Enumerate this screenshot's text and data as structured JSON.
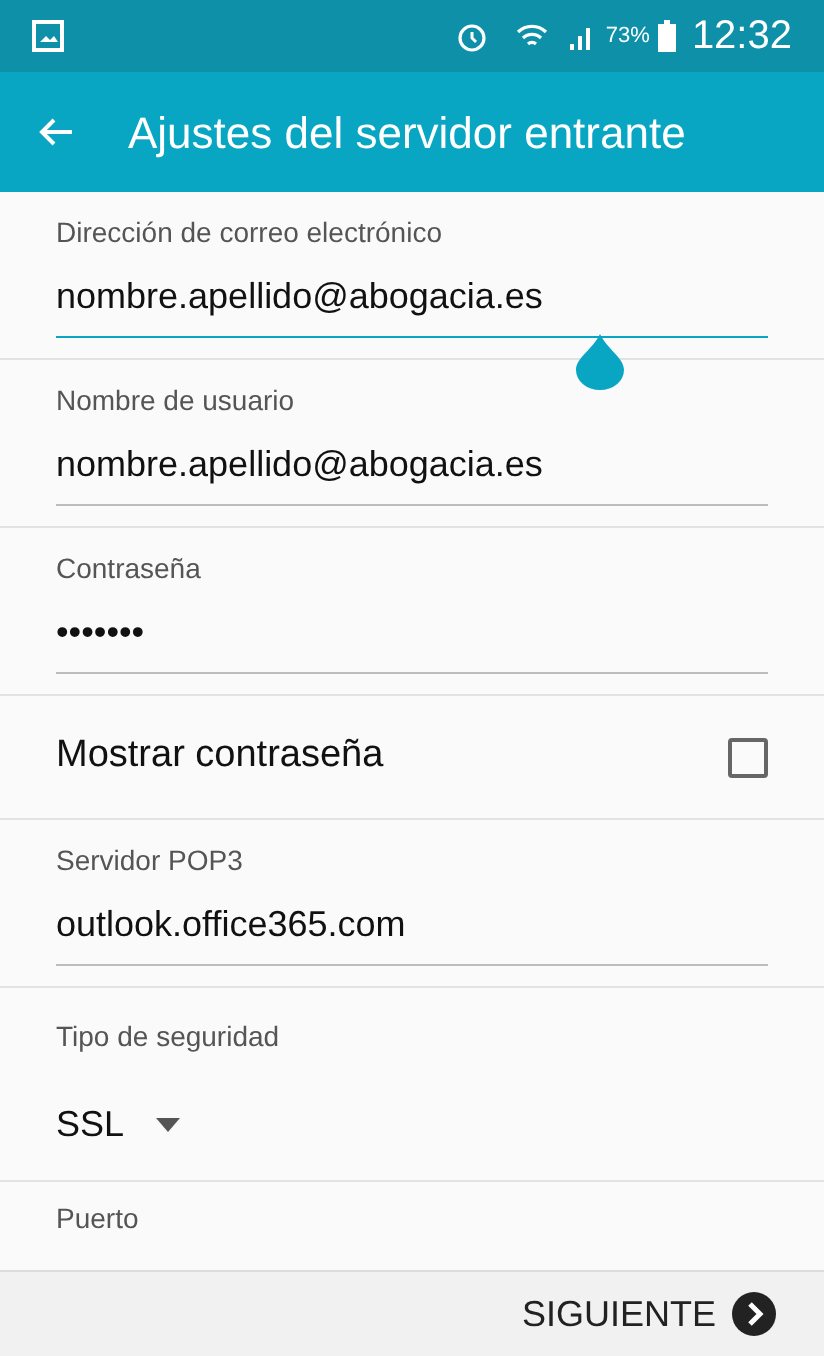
{
  "status_bar": {
    "battery": "73%",
    "time": "12:32"
  },
  "app_bar": {
    "title": "Ajustes del servidor entrante"
  },
  "fields": [
    {
      "kind": "text",
      "label": "Dirección de correo electrónico",
      "value": "nombre.apellido@abogacia.es",
      "focused": true
    },
    {
      "kind": "text",
      "label": "Nombre de usuario",
      "value": "nombre.apellido@abogacia.es",
      "focused": false
    },
    {
      "kind": "password",
      "label": "Contraseña",
      "value": "•••••••",
      "focused": false
    },
    {
      "kind": "checkbox",
      "label": "Mostrar contraseña",
      "checked": false
    },
    {
      "kind": "text",
      "label": "Servidor POP3",
      "value": "outlook.office365.com",
      "focused": false
    },
    {
      "kind": "dropdown",
      "label": "Tipo de seguridad",
      "value": "SSL"
    },
    {
      "kind": "partial",
      "label": "Puerto"
    }
  ],
  "footer": {
    "button": "SIGUIENTE"
  }
}
